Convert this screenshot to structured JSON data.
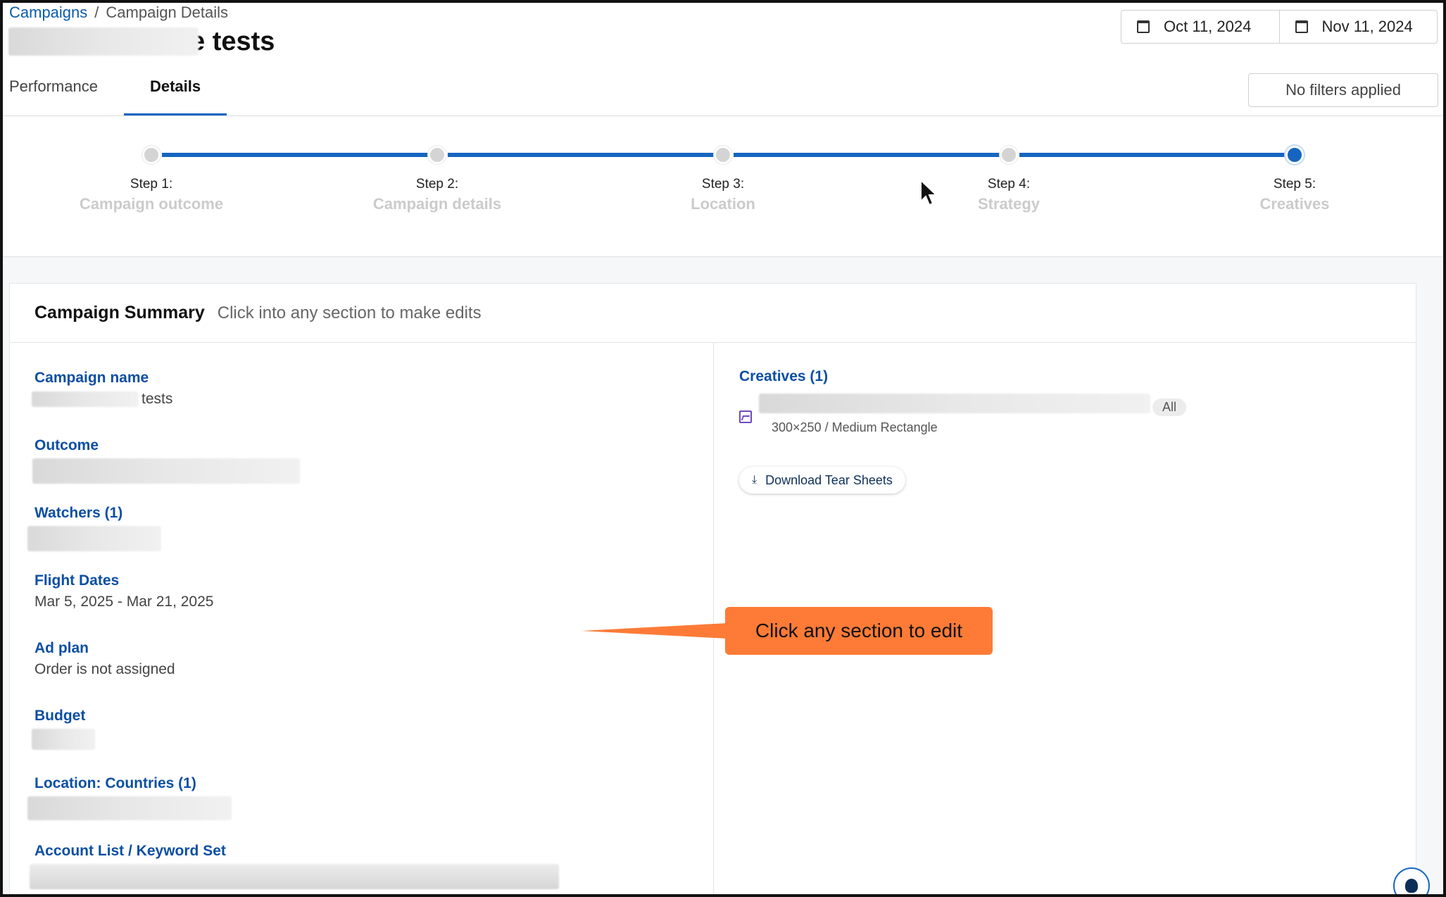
{
  "breadcrumb": {
    "root": "Campaigns",
    "separator": "/",
    "current": "Campaign Details"
  },
  "page_title": "e tests",
  "tabs": [
    {
      "label": "Performance",
      "active": false
    },
    {
      "label": "Details",
      "active": true
    }
  ],
  "date_range": {
    "start": "Oct 11, 2024",
    "end": "Nov 11, 2024"
  },
  "filters_button": "No filters applied",
  "steps": [
    {
      "label": "Step 1:",
      "name": "Campaign outcome",
      "active": false
    },
    {
      "label": "Step 2:",
      "name": "Campaign details",
      "active": false
    },
    {
      "label": "Step 3:",
      "name": "Location",
      "active": false
    },
    {
      "label": "Step 4:",
      "name": "Strategy",
      "active": false
    },
    {
      "label": "Step 5:",
      "name": "Creatives",
      "active": true
    }
  ],
  "summary": {
    "title": "Campaign Summary",
    "hint": "Click into any section to make edits",
    "fields": {
      "campaign_name": {
        "label": "Campaign name",
        "value": "tests"
      },
      "outcome": {
        "label": "Outcome"
      },
      "watchers": {
        "label": "Watchers (1)"
      },
      "flight_dates": {
        "label": "Flight Dates",
        "value": "Mar 5, 2025 - Mar 21, 2025"
      },
      "ad_plan": {
        "label": "Ad plan",
        "value": "Order is not assigned"
      },
      "budget": {
        "label": "Budget"
      },
      "location": {
        "label": "Location: Countries (1)"
      },
      "account_list": {
        "label": "Account List / Keyword Set"
      }
    },
    "creatives": {
      "label": "Creatives (1)",
      "chip": "All",
      "size": "300×250 / Medium Rectangle",
      "download_label": "Download Tear Sheets"
    }
  },
  "callout": "Click any section to edit",
  "colors": {
    "accent": "#1565c0",
    "link": "#0b4fa3",
    "callout": "#fd7b36"
  }
}
